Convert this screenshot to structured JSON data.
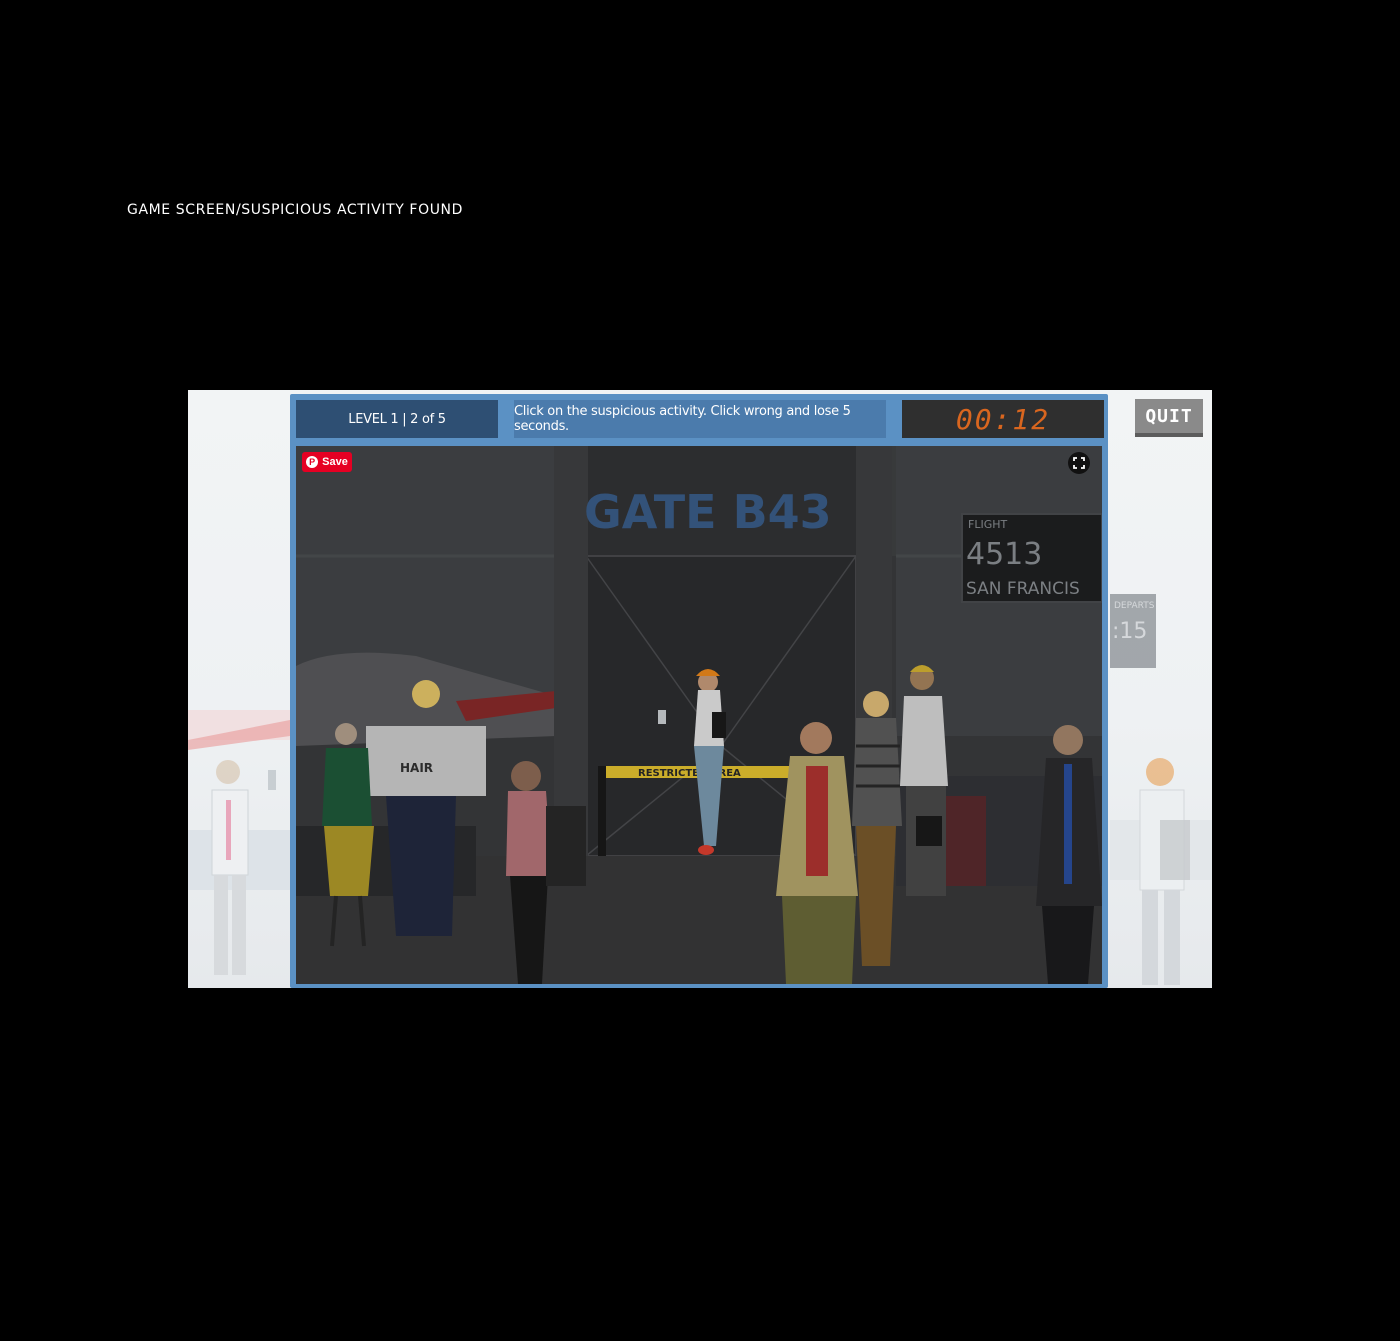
{
  "caption": "GAME SCREEN/SUSPICIOUS ACTIVITY FOUND",
  "hud": {
    "level": "LEVEL 1 | 2 of 5",
    "instruction": "Click on the suspicious activity. Click wrong and lose 5 seconds.",
    "timer": "00:12"
  },
  "quit_label": "QUIT",
  "save_label": "Save",
  "scene": {
    "gate_sign": "GATE B43",
    "board": {
      "header": "FLIGHT",
      "flight_number": "4513",
      "destination": "SAN FRANCIS",
      "departs_label": "DEPARTS",
      "departs_time": ":15"
    },
    "restricted_tape": "RESTRICTED AREA",
    "newspaper": "HAIR"
  },
  "colors": {
    "frame": "#5b91c4",
    "hud_level": "#2e4f73",
    "hud_instruction": "#4b7bac",
    "timer_digits": "#d9661f",
    "tape": "#e8c530",
    "save": "#e60023"
  }
}
